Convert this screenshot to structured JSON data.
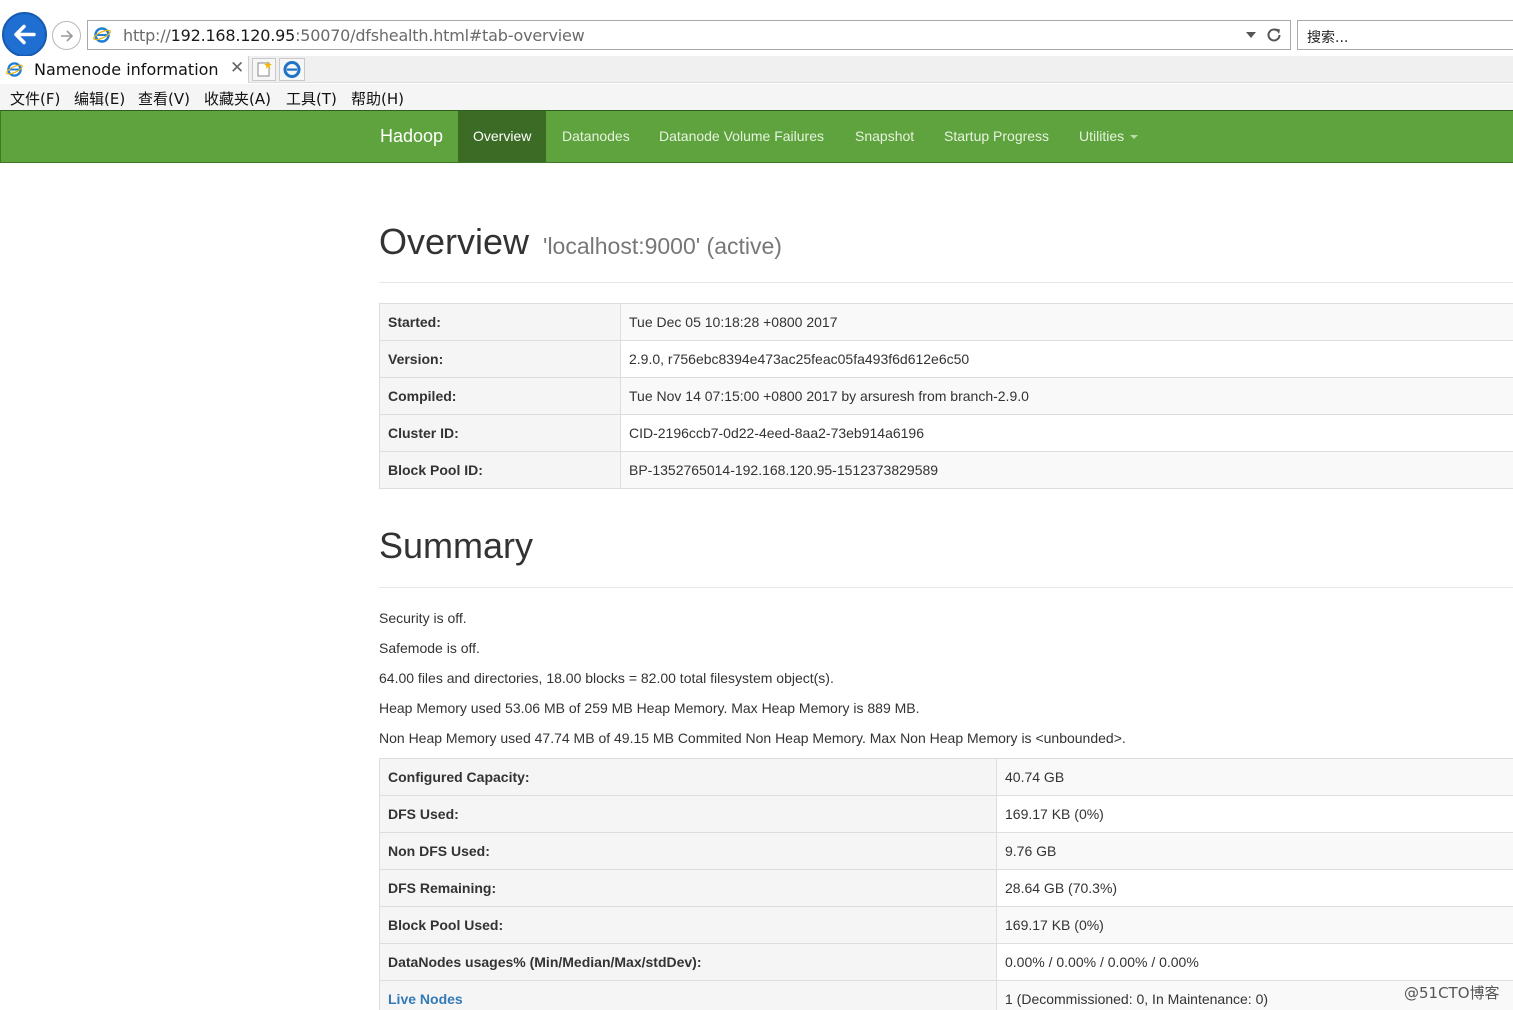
{
  "browser": {
    "url_prefix": "http://",
    "url_host": "192.168.120.95",
    "url_rest": ":50070/dfshealth.html#tab-overview",
    "search_placeholder": "搜索...",
    "tab_title": "Namenode information",
    "tab_close": "✕",
    "menu": [
      "文件(F)",
      "编辑(E)",
      "查看(V)",
      "收藏夹(A)",
      "工具(T)",
      "帮助(H)"
    ]
  },
  "navbar": {
    "brand": "Hadoop",
    "items": [
      "Overview",
      "Datanodes",
      "Datanode Volume Failures",
      "Snapshot",
      "Startup Progress",
      "Utilities"
    ],
    "active": "Overview"
  },
  "overview": {
    "title": "Overview",
    "subtitle": "'localhost:9000' (active)",
    "rows": [
      {
        "key": "Started:",
        "value": "Tue Dec 05 10:18:28 +0800 2017"
      },
      {
        "key": "Version:",
        "value": "2.9.0, r756ebc8394e473ac25feac05fa493f6d612e6c50"
      },
      {
        "key": "Compiled:",
        "value": "Tue Nov 14 07:15:00 +0800 2017 by arsuresh from branch-2.9.0"
      },
      {
        "key": "Cluster ID:",
        "value": "CID-2196ccb7-0d22-4eed-8aa2-73eb914a6196"
      },
      {
        "key": "Block Pool ID:",
        "value": "BP-1352765014-192.168.120.95-1512373829589"
      }
    ]
  },
  "summary": {
    "title": "Summary",
    "lines": [
      "Security is off.",
      "Safemode is off.",
      "64.00 files and directories, 18.00 blocks = 82.00 total filesystem object(s).",
      "Heap Memory used 53.06 MB of 259 MB Heap Memory. Max Heap Memory is 889 MB.",
      "Non Heap Memory used 47.74 MB of 49.15 MB Commited Non Heap Memory. Max Non Heap Memory is <unbounded>."
    ],
    "rows": [
      {
        "key": "Configured Capacity:",
        "value": "40.74 GB"
      },
      {
        "key": "DFS Used:",
        "value": "169.17 KB (0%)"
      },
      {
        "key": "Non DFS Used:",
        "value": "9.76 GB"
      },
      {
        "key": "DFS Remaining:",
        "value": "28.64 GB (70.3%)"
      },
      {
        "key": "Block Pool Used:",
        "value": "169.17 KB (0%)"
      },
      {
        "key": "DataNodes usages% (Min/Median/Max/stdDev):",
        "value": "0.00% / 0.00% / 0.00% / 0.00%"
      },
      {
        "key": "Live Nodes",
        "value": "1 (Decommissioned: 0, In Maintenance: 0)",
        "link": true
      }
    ]
  },
  "watermark": "@51CTO博客",
  "colors": {
    "navbar": "#5fa33e",
    "navbar_active": "#3b6b24",
    "link": "#337ab7"
  }
}
